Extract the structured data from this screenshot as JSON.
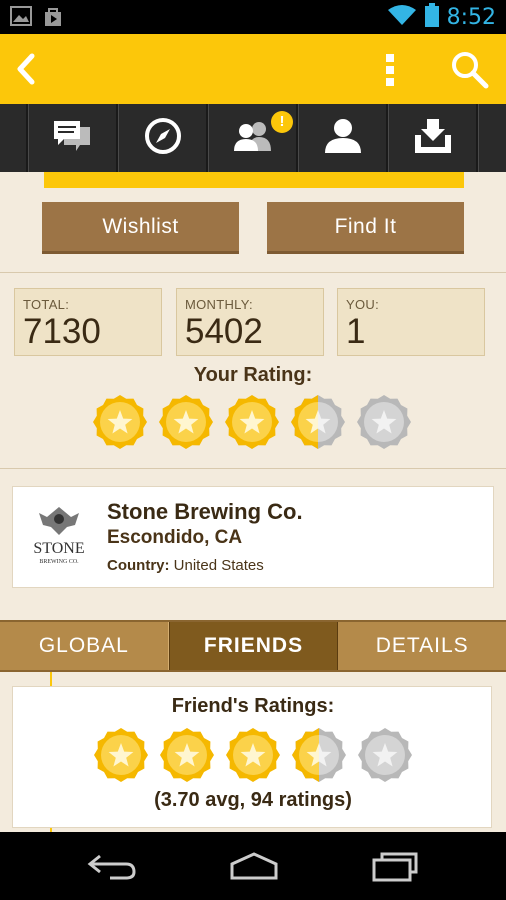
{
  "status_bar": {
    "time": "8:52",
    "icons": [
      "gallery-icon",
      "play-store-icon",
      "wifi-icon",
      "battery-icon"
    ]
  },
  "app_bar": {
    "back": "back-icon",
    "overflow": "overflow-menu-icon",
    "search": "search-icon",
    "color": "#fcc70a"
  },
  "nav": {
    "items": [
      {
        "name": "chat-icon"
      },
      {
        "name": "compass-icon"
      },
      {
        "name": "friends-icon",
        "badge": "!"
      },
      {
        "name": "profile-icon"
      },
      {
        "name": "inbox-download-icon"
      }
    ]
  },
  "actions": {
    "wishlist": "Wishlist",
    "find_it": "Find It"
  },
  "stats": [
    {
      "label": "TOTAL:",
      "value": "7130"
    },
    {
      "label": "MONTHLY:",
      "value": "5402"
    },
    {
      "label": "YOU:",
      "value": "1"
    }
  ],
  "your_rating": {
    "label": "Your Rating:",
    "stars": 3.5,
    "max": 5
  },
  "brewery": {
    "name": "Stone Brewing Co.",
    "location": "Escondido, CA",
    "country_label": "Country:",
    "country": "United States",
    "logo_text": "STONE",
    "logo_sub": "BREWING CO."
  },
  "tabs": [
    {
      "label": "GLOBAL",
      "active": false
    },
    {
      "label": "FRIENDS",
      "active": true
    },
    {
      "label": "DETAILS",
      "active": false
    }
  ],
  "friends": {
    "title": "Friend's Ratings:",
    "stars": 3.5,
    "max": 5,
    "summary": "(3.70 avg, 94 ratings)"
  },
  "colors": {
    "accent": "#fcc70a",
    "button": "#9c7446",
    "tab_active": "#7f5a1e",
    "tab": "#b48a4a",
    "background": "#f3ebdd"
  }
}
